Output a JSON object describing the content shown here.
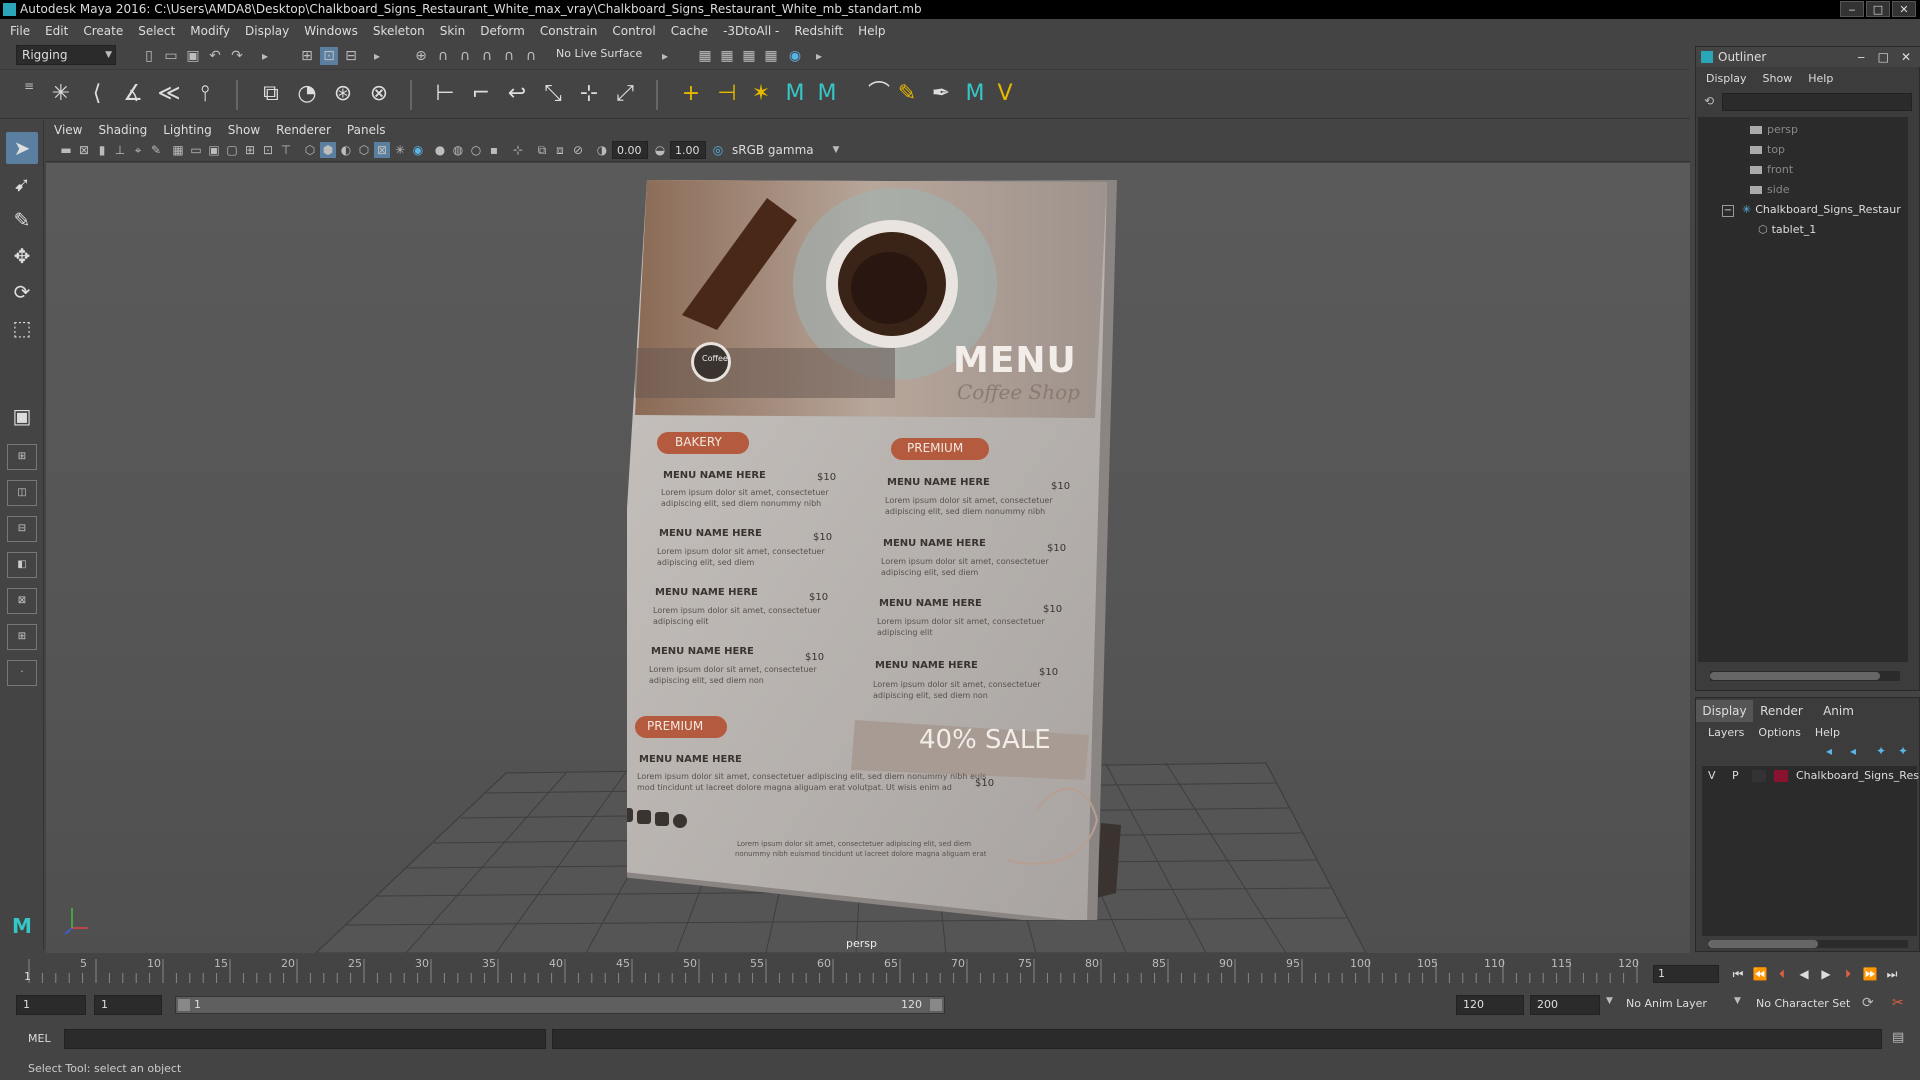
{
  "window": {
    "title": "Autodesk Maya 2016: C:\\Users\\AMDA8\\Desktop\\Chalkboard_Signs_Restaurant_White_max_vray\\Chalkboard_Signs_Restaurant_White_mb_standart.mb",
    "min": "‒",
    "max": "□",
    "close": "✕"
  },
  "menubar": [
    "File",
    "Edit",
    "Create",
    "Select",
    "Modify",
    "Display",
    "Windows",
    "Skeleton",
    "Skin",
    "Deform",
    "Constrain",
    "Control",
    "Cache",
    "-3DtoAll -",
    "Redshift",
    "Help"
  ],
  "statusline": {
    "mode": "Rigging",
    "live_surface": "No Live Surface"
  },
  "panel": {
    "menus": [
      "View",
      "Shading",
      "Lighting",
      "Show",
      "Renderer",
      "Panels"
    ],
    "exposure": "0.00",
    "gamma": "1.00",
    "colorspace": "sRGB gamma",
    "camera": "persp"
  },
  "poster": {
    "brand": "Coffee",
    "title": "MENU",
    "subtitle": "Coffee Shop",
    "left": {
      "tag": "BAKERY",
      "items": [
        {
          "name": "MENU NAME HERE",
          "price": "$10",
          "desc1": "Lorem ipsum dolor sit amet, consectetuer",
          "desc2": "adipiscing elit, sed diem nonummy nibh"
        },
        {
          "name": "MENU NAME HERE",
          "price": "$10",
          "desc1": "Lorem ipsum dolor sit amet, consectetuer",
          "desc2": "adipiscing elit, sed diem"
        },
        {
          "name": "MENU NAME HERE",
          "price": "$10",
          "desc1": "Lorem ipsum dolor sit amet, consectetuer",
          "desc2": "adipiscing elit"
        },
        {
          "name": "MENU NAME HERE",
          "price": "$10",
          "desc1": "Lorem ipsum dolor sit amet, consectetuer",
          "desc2": "adipiscing elit, sed diem non"
        }
      ]
    },
    "right": {
      "tag": "PREMIUM",
      "items": [
        {
          "name": "MENU NAME HERE",
          "price": "$10",
          "desc1": "Lorem ipsum dolor sit amet, consectetuer",
          "desc2": "adipiscing elit, sed diem nonummy nibh"
        },
        {
          "name": "MENU NAME HERE",
          "price": "$10",
          "desc1": "Lorem ipsum dolor sit amet, consectetuer",
          "desc2": "adipiscing elit, sed diem"
        },
        {
          "name": "MENU NAME HERE",
          "price": "$10",
          "desc1": "Lorem ipsum dolor sit amet, consectetuer",
          "desc2": "adipiscing elit"
        },
        {
          "name": "MENU NAME HERE",
          "price": "$10",
          "desc1": "Lorem ipsum dolor sit amet, consectetuer",
          "desc2": "adipiscing elit, sed diem non"
        }
      ]
    },
    "bottom": {
      "tag": "PREMIUM",
      "name": "MENU NAME HERE",
      "desc1": "Lorem ipsum dolor sit amet, consectetuer adipiscing elit, sed diem nonummy nibh euis",
      "desc2": "mod tincidunt ut lacreet dolore magna aliguam erat volutpat. Ut wisis enim ad",
      "sale": "40% SALE",
      "sale_price": "$10",
      "foot1": "Lorem ipsum dolor sit amet, consectetuer adipiscing elit, sed diem",
      "foot2": "nonummy nibh euismod tincidunt ut lacreet dolore magna aliguam erat"
    }
  },
  "outliner": {
    "title": "Outliner",
    "menus": [
      "Display",
      "Show",
      "Help"
    ],
    "items": [
      "persp",
      "top",
      "front",
      "side",
      "Chalkboard_Signs_Restaur",
      "tablet_1"
    ]
  },
  "layers": {
    "tabs": [
      "Display",
      "Render",
      "Anim"
    ],
    "menus": [
      "Layers",
      "Options",
      "Help"
    ],
    "row": {
      "v": "V",
      "p": "P",
      "name": "Chalkboard_Signs_Res",
      "color": "#8a1230"
    }
  },
  "timeline": {
    "ticks": [
      "5",
      "10",
      "15",
      "20",
      "25",
      "30",
      "35",
      "40",
      "45",
      "50",
      "55",
      "60",
      "65",
      "70",
      "75",
      "80",
      "85",
      "90",
      "95",
      "100",
      "105",
      "110",
      "115",
      "120"
    ],
    "start_mark": "1",
    "current": "1"
  },
  "range": {
    "start": "1",
    "inner_start": "1",
    "bar_start": "1",
    "bar_end": "120",
    "end": "120",
    "max": "200",
    "anim_layer": "No Anim Layer",
    "char_set": "No Character Set"
  },
  "cmd": {
    "lang": "MEL"
  },
  "help": "Select Tool: select an object"
}
